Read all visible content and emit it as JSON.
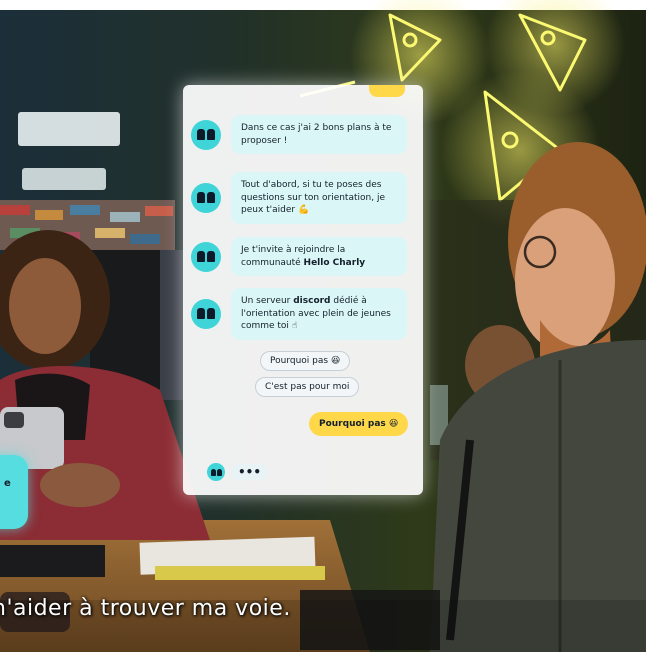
{
  "chat": {
    "messages": [
      {
        "parts": [
          "Dans ce cas j'ai 2 bons plans à te proposer !"
        ],
        "emoji": ""
      },
      {
        "parts": [
          "Tout d'abord, si tu te poses des questions sur ton orientation, je peux t'aider"
        ],
        "emoji": "💪"
      },
      {
        "pre": "Je t'invite à rejoindre la communauté ",
        "bold": "Hello Charly",
        "post": ""
      },
      {
        "pre": "Un serveur ",
        "bold": "discord",
        "post": " dédié à l'orientation avec plein de jeunes comme toi",
        "emoji": "☝"
      }
    ],
    "choices": [
      "Pourquoi pas 😆",
      "C'est pas pour moi"
    ],
    "user_reply": "Pourquoi pas 😆",
    "typing": "•••"
  },
  "side_bubble_text": "e",
  "subtitle": "n'aider à trouver ma voie.",
  "colors": {
    "bot": "#3ed4d8",
    "bot_bubble": "#dbf6f7",
    "user_bubble": "#ffd84a",
    "neon": "#f5f24a"
  }
}
